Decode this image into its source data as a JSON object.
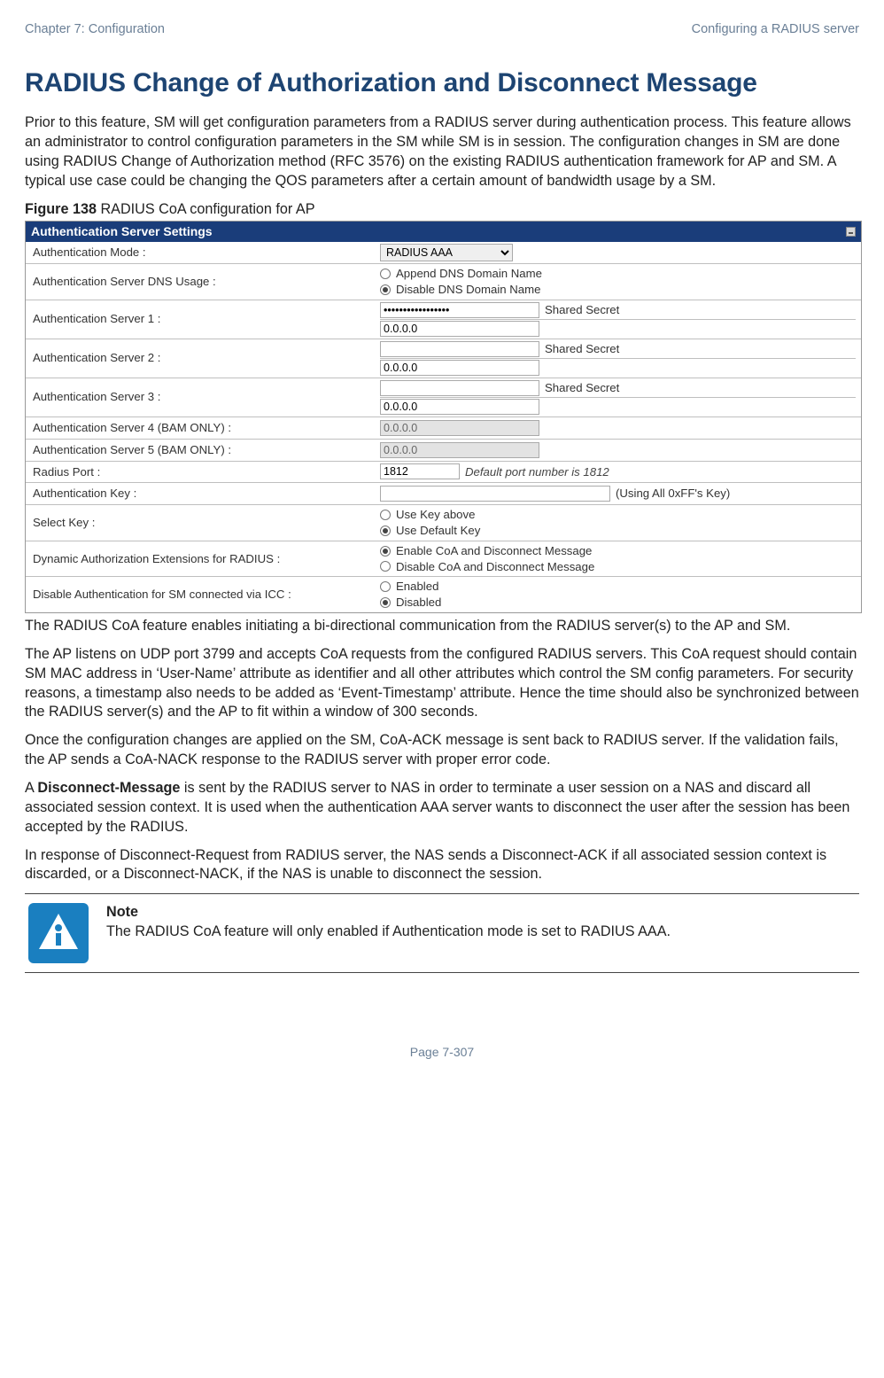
{
  "header": {
    "left": "Chapter 7:  Configuration",
    "right": "Configuring a RADIUS server"
  },
  "h1": "RADIUS Change of Authorization and Disconnect Message",
  "p1": "Prior to this feature, SM will get configuration parameters from a RADIUS server during authentication process. This feature allows an administrator to control configuration parameters in the SM while SM is in session. The configuration changes in SM are done using RADIUS Change of Authorization method (RFC 3576) on the existing RADIUS authentication framework for AP and SM. A typical use case could be changing the QOS parameters after a certain amount of bandwidth usage by a SM.",
  "figCap": {
    "bold": "Figure 138",
    "rest": " RADIUS CoA configuration for AP"
  },
  "panel": {
    "title": "Authentication Server Settings",
    "rows": {
      "authMode": {
        "label": "Authentication Mode :",
        "value": "RADIUS AAA"
      },
      "dnsUsage": {
        "label": "Authentication Server DNS Usage :",
        "opt1": "Append DNS Domain Name",
        "opt2": "Disable DNS Domain Name"
      },
      "srv1": {
        "label": "Authentication Server 1 :",
        "secret": "•••••••••••••••••",
        "sharedLabel": "Shared Secret",
        "addr": "0.0.0.0"
      },
      "srv2": {
        "label": "Authentication Server 2 :",
        "secret": "",
        "sharedLabel": "Shared Secret",
        "addr": "0.0.0.0"
      },
      "srv3": {
        "label": "Authentication Server 3 :",
        "secret": "",
        "sharedLabel": "Shared Secret",
        "addr": "0.0.0.0"
      },
      "srv4": {
        "label": "Authentication Server 4 (BAM ONLY) :",
        "addr": "0.0.0.0"
      },
      "srv5": {
        "label": "Authentication Server 5 (BAM ONLY) :",
        "addr": "0.0.0.0"
      },
      "port": {
        "label": "Radius Port :",
        "value": "1812",
        "hint": "Default port number is 1812"
      },
      "authKey": {
        "label": "Authentication Key :",
        "value": "",
        "hint": "(Using All 0xFF's Key)"
      },
      "selectKey": {
        "label": "Select Key :",
        "opt1": "Use Key above",
        "opt2": "Use Default Key"
      },
      "dynAuth": {
        "label": "Dynamic Authorization Extensions for RADIUS :",
        "opt1": "Enable CoA and Disconnect Message",
        "opt2": "Disable CoA and Disconnect Message"
      },
      "disableAuth": {
        "label": "Disable Authentication for SM connected via ICC :",
        "opt1": "Enabled",
        "opt2": "Disabled"
      }
    }
  },
  "p2": "The RADIUS CoA feature enables initiating a bi-directional communication from the RADIUS server(s) to the AP and SM.",
  "p3": "The AP listens on UDP port 3799 and accepts CoA requests from the configured RADIUS servers. This CoA request should contain SM MAC address in ‘User-Name’ attribute as identifier and all other attributes which control the SM config parameters. For security reasons, a timestamp also needs to be added as ‘Event-Timestamp’ attribute. Hence the time should also be synchronized between the RADIUS server(s) and the AP to fit within a window of 300 seconds.",
  "p4": "Once the configuration changes are applied on the SM, CoA-ACK message is sent back to RADIUS server. If the validation fails, the AP sends a CoA-NACK response to the RADIUS server with proper error code.",
  "p5a": "A ",
  "p5b": "Disconnect-Message",
  "p5c": " is sent by the RADIUS server to NAS in order to terminate a user session on a NAS and discard all associated session context. It is used when the authentication AAA server wants to disconnect the user after the session has been accepted by the RADIUS.",
  "p6": "In response of Disconnect-Request from RADIUS server, the NAS sends a Disconnect-ACK if all associated session context is discarded, or a Disconnect-NACK, if the NAS is unable to disconnect the session.",
  "note": {
    "title": "Note",
    "body": "The RADIUS CoA feature will only enabled if Authentication mode is set to RADIUS AAA."
  },
  "footer": "Page 7-307"
}
